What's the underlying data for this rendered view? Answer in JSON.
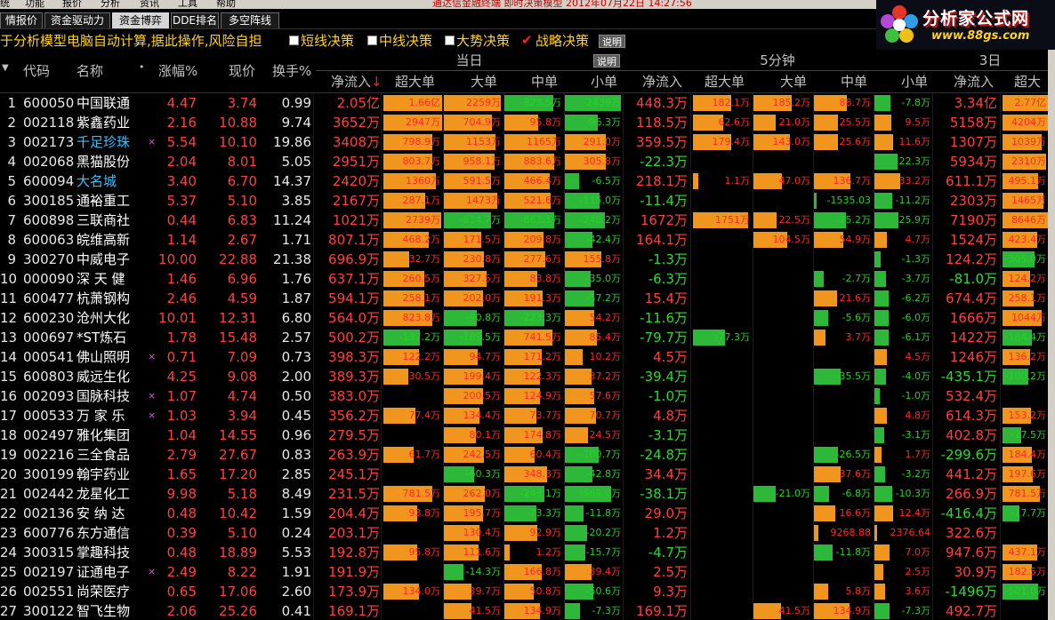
{
  "menubar": {
    "items": [
      "统",
      "功能",
      "报价",
      "分析",
      "资讯",
      "工具",
      "帮助"
    ],
    "title": "通达信金融终端  即时决策模型  2012年07月22日 14:27:56"
  },
  "tabs": [
    {
      "label": "情报价",
      "active": false
    },
    {
      "label": "资金驱动力",
      "active": false
    },
    {
      "label": "资金博弈",
      "active": true
    },
    {
      "label": "DDE排名",
      "active": false
    },
    {
      "label": "多空阵线",
      "active": false
    }
  ],
  "logo": {
    "title": "分析家公式网",
    "url": "www.88gs.com"
  },
  "decision_bar": {
    "text": "于分析模型电脑自动计算,据此操作,风险自担",
    "options": [
      {
        "label": "短线决策",
        "checked": false
      },
      {
        "label": "中线决策",
        "checked": false
      },
      {
        "label": "大势决策",
        "checked": false
      },
      {
        "label": "战略决策",
        "checked": true
      }
    ],
    "explain_label": "说明"
  },
  "header": {
    "columns": {
      "code": "代码",
      "name": "名称",
      "dot": "•",
      "change": "涨幅%",
      "price": "现价",
      "turnover": "换手%"
    },
    "sort_arrow": "↓",
    "groups": [
      {
        "label": "当日",
        "explain": "说明"
      },
      {
        "label": "5分钟",
        "explain": ""
      },
      {
        "label": "3日",
        "explain": ""
      }
    ],
    "sub": [
      "净流入",
      "超大单",
      "大单",
      "中单",
      "小单"
    ],
    "sub5": [
      "净流入",
      "超大单",
      "大单",
      "中单",
      "小单"
    ],
    "sub3": [
      "净流入",
      "超大"
    ]
  },
  "rows": [
    {
      "idx": "1",
      "code": "600050",
      "name": "中国联通",
      "mark": "",
      "hl": false,
      "chg": "4.47",
      "price": "3.74",
      "to": "0.99",
      "n1": "2.05亿",
      "b1": [
        "1.66亿",
        "2259万",
        "-823.5万",
        "-2439万"
      ],
      "n5": "448.3万",
      "b5": [
        "182.1万",
        "185.2万",
        "88.7万",
        "-7.8万"
      ],
      "n3": "3.34亿",
      "b3": "2.77亿"
    },
    {
      "idx": "2",
      "code": "002118",
      "name": "紫鑫药业",
      "mark": "",
      "hl": false,
      "chg": "2.16",
      "price": "10.88",
      "to": "9.74",
      "n1": "3652万",
      "b1": [
        "2947万",
        "704.9万",
        "95.8万",
        "-96.3万"
      ],
      "n5": "118.5万",
      "b5": [
        "62.6万",
        "21.0万",
        "25.5万",
        "9.5万"
      ],
      "n3": "5158万",
      "b3": "4204万"
    },
    {
      "idx": "3",
      "code": "002173",
      "name": "千足珍珠",
      "mark": "×",
      "hl": true,
      "chg": "5.54",
      "price": "10.10",
      "to": "19.86",
      "n1": "3408万",
      "b1": [
        "798.9万",
        "1153万",
        "1165万",
        "291.0万"
      ],
      "n5": "359.5万",
      "b5": [
        "179.4万",
        "143.0万",
        "25.6万",
        "11.6万"
      ],
      "n3": "1307万",
      "b3": "1039万"
    },
    {
      "idx": "4",
      "code": "002068",
      "name": "黑猫股份",
      "mark": "",
      "hl": false,
      "chg": "2.04",
      "price": "8.01",
      "to": "5.05",
      "n1": "2951万",
      "b1": [
        "803.7万",
        "958.1万",
        "883.6万",
        "305.8万"
      ],
      "n5": "-22.3万",
      "b5": [
        "",
        "",
        "",
        "-22.3万"
      ],
      "n3": "5934万",
      "b3": "2310万"
    },
    {
      "idx": "5",
      "code": "600094",
      "name": "大名城",
      "mark": "",
      "hl": true,
      "chg": "3.40",
      "price": "6.70",
      "to": "14.37",
      "n1": "2420万",
      "b1": [
        "1360万",
        "591.5万",
        "466.4万",
        "-6.5万"
      ],
      "n5": "218.1万",
      "b5": [
        "1.1万",
        "47.0万",
        "136.7万",
        "33.2万"
      ],
      "n3": "611.1万",
      "b3": "495.1万"
    },
    {
      "idx": "6",
      "code": "300185",
      "name": "通裕重工",
      "mark": "",
      "hl": false,
      "chg": "5.37",
      "price": "5.10",
      "to": "3.85",
      "n1": "2167万",
      "b1": [
        "287.1万",
        "1473万",
        "521.6万",
        "-115.0万"
      ],
      "n5": "-11.4万",
      "b5": [
        "",
        "",
        "-1535.03",
        "-11.2万"
      ],
      "n3": "2303万",
      "b3": "1465万"
    },
    {
      "idx": "7",
      "code": "600898",
      "name": "三联商社",
      "mark": "",
      "hl": false,
      "chg": "0.44",
      "price": "6.83",
      "to": "11.24",
      "n1": "1021万",
      "b1": [
        "2739万",
        "-614.7万",
        "-863.1万",
        "-240.2万"
      ],
      "n5": "1672万",
      "b5": [
        "1751万",
        "22.5万",
        "-75.2万",
        "-25.9万"
      ],
      "n3": "7190万",
      "b3": "8646万"
    },
    {
      "idx": "8",
      "code": "600063",
      "name": "皖维高新",
      "mark": "",
      "hl": false,
      "chg": "1.14",
      "price": "2.67",
      "to": "1.71",
      "n1": "807.1万",
      "b1": [
        "468.2万",
        "171.5万",
        "209.8万",
        "-42.4万"
      ],
      "n5": "164.1万",
      "b5": [
        "",
        "104.5万",
        "54.9万",
        "4.7万"
      ],
      "n3": "1524万",
      "b3": "423.4万"
    },
    {
      "idx": "9",
      "code": "300270",
      "name": "中威电子",
      "mark": "",
      "hl": false,
      "chg": "10.00",
      "price": "22.88",
      "to": "21.38",
      "n1": "696.9万",
      "b1": [
        "32.7万",
        "230.8万",
        "277.6万",
        "155.8万"
      ],
      "n5": "-1.3万",
      "b5": [
        "",
        "",
        "",
        "-1.3万"
      ],
      "n3": "124.2万",
      "b3": "-305.0万"
    },
    {
      "idx": "10",
      "code": "000090",
      "name": "深 天 健",
      "mark": "",
      "hl": false,
      "chg": "1.46",
      "price": "6.96",
      "to": "1.76",
      "n1": "637.1万",
      "b1": [
        "260.5万",
        "327.5万",
        "83.8万",
        "-35.0万"
      ],
      "n5": "-6.3万",
      "b5": [
        "",
        "",
        "-2.7万",
        "-3.7万"
      ],
      "n3": "-81.0万",
      "b3": "124.2万"
    },
    {
      "idx": "11",
      "code": "600477",
      "name": "杭萧钢构",
      "mark": "",
      "hl": false,
      "chg": "2.46",
      "price": "4.59",
      "to": "1.87",
      "n1": "594.1万",
      "b1": [
        "258.1万",
        "202.0万",
        "191.3万",
        "-57.2万"
      ],
      "n5": "15.4万",
      "b5": [
        "",
        "",
        "21.6万",
        "-6.2万"
      ],
      "n3": "674.4万",
      "b3": "258.1万"
    },
    {
      "idx": "12",
      "code": "600230",
      "name": "沧州大化",
      "mark": "",
      "hl": false,
      "chg": "10.01",
      "price": "12.31",
      "to": "6.80",
      "n1": "564.0万",
      "b1": [
        "823.8万",
        "-90.8万",
        "-223.3万",
        "54.2万"
      ],
      "n5": "-11.6万",
      "b5": [
        "",
        "",
        "-5.6万",
        "-6.0万"
      ],
      "n3": "1666万",
      "b3": "1044万"
    },
    {
      "idx": "13",
      "code": "000697",
      "name": "*ST炼石",
      "mark": "",
      "hl": false,
      "chg": "1.78",
      "price": "15.48",
      "to": "2.57",
      "n1": "500.2万",
      "b1": [
        "-137.2万",
        "-189.5万",
        "741.5万",
        "85.4万"
      ],
      "n5": "-79.7万",
      "b5": [
        "-77.3万",
        "",
        "3.7万",
        "-6.1万"
      ],
      "n3": "1422万",
      "b3": "-184.4万"
    },
    {
      "idx": "14",
      "code": "000541",
      "name": "佛山照明",
      "mark": "×",
      "hl": false,
      "chg": "0.71",
      "price": "7.09",
      "to": "0.73",
      "n1": "398.3万",
      "b1": [
        "122.2万",
        "94.7万",
        "171.2万",
        "10.2万"
      ],
      "n5": "4.5万",
      "b5": [
        "",
        "",
        "",
        "4.5万"
      ],
      "n3": "1246万",
      "b3": "136.2万"
    },
    {
      "idx": "15",
      "code": "600803",
      "name": "威远生化",
      "mark": "",
      "hl": false,
      "chg": "4.25",
      "price": "9.08",
      "to": "2.00",
      "n1": "389.3万",
      "b1": [
        "30.5万",
        "199.4万",
        "122.3万",
        "37.2万"
      ],
      "n5": "-39.4万",
      "b5": [
        "",
        "",
        "-35.5万",
        "-4.0万"
      ],
      "n3": "-435.1万",
      "b3": "-100.2万"
    },
    {
      "idx": "16",
      "code": "002093",
      "name": "国脉科技",
      "mark": "×",
      "hl": false,
      "chg": "1.07",
      "price": "4.74",
      "to": "0.50",
      "n1": "383.0万",
      "b1": [
        "",
        "200.5万",
        "124.9万",
        "57.6万"
      ],
      "n5": "-1.0万",
      "b5": [
        "",
        "",
        "",
        "-1.0万"
      ],
      "n3": "532.4万",
      "b3": ""
    },
    {
      "idx": "17",
      "code": "000533",
      "name": "万 家 乐",
      "mark": "×",
      "hl": false,
      "chg": "1.03",
      "price": "3.94",
      "to": "0.45",
      "n1": "356.2万",
      "b1": [
        "77.4万",
        "134.4万",
        "73.7万",
        "70.7万"
      ],
      "n5": "4.8万",
      "b5": [
        "",
        "",
        "",
        "4.8万"
      ],
      "n3": "614.3万",
      "b3": "153.2万"
    },
    {
      "idx": "18",
      "code": "002497",
      "name": "雅化集团",
      "mark": "",
      "hl": false,
      "chg": "1.04",
      "price": "14.55",
      "to": "0.96",
      "n1": "279.5万",
      "b1": [
        "",
        "80.1万",
        "174.8万",
        "24.5万"
      ],
      "n5": "-3.1万",
      "b5": [
        "",
        "",
        "",
        "-3.1万"
      ],
      "n3": "402.8万",
      "b3": "-27.5万"
    },
    {
      "idx": "19",
      "code": "002216",
      "name": "三全食品",
      "mark": "",
      "hl": false,
      "chg": "2.79",
      "price": "27.67",
      "to": "0.83",
      "n1": "263.9万",
      "b1": [
        "61.7万",
        "242.5万",
        "60.4万",
        "-100.7万"
      ],
      "n5": "-24.8万",
      "b5": [
        "",
        "",
        "-26.5万",
        "1.7万"
      ],
      "n3": "-299.6万",
      "b3": "184.4万"
    },
    {
      "idx": "20",
      "code": "300199",
      "name": "翰宇药业",
      "mark": "",
      "hl": false,
      "chg": "1.65",
      "price": "17.20",
      "to": "2.85",
      "n1": "245.1万",
      "b1": [
        "",
        "-60.3万",
        "348.3万",
        "-42.8万"
      ],
      "n5": "34.4万",
      "b5": [
        "",
        "",
        "37.6万",
        "-3.2万"
      ],
      "n3": "441.2万",
      "b3": "197.6万"
    },
    {
      "idx": "21",
      "code": "002442",
      "name": "龙星化工",
      "mark": "",
      "hl": false,
      "chg": "9.98",
      "price": "5.18",
      "to": "8.49",
      "n1": "231.5万",
      "b1": [
        "781.5万",
        "262.0万",
        "-243.1万",
        "-569.0万"
      ],
      "n5": "-38.1万",
      "b5": [
        "",
        "-21.0万",
        "-6.8万",
        "-10.3万"
      ],
      "n3": "266.9万",
      "b3": "781.5万"
    },
    {
      "idx": "22",
      "code": "002136",
      "name": "安 纳 达",
      "mark": "",
      "hl": false,
      "chg": "0.48",
      "price": "10.42",
      "to": "1.59",
      "n1": "204.4万",
      "b1": [
        "93.8万",
        "195.7万",
        "-73.3万",
        "-11.8万"
      ],
      "n5": "29.0万",
      "b5": [
        "",
        "",
        "16.6万",
        "12.4万"
      ],
      "n3": "-416.4万",
      "b3": "-17.7万"
    },
    {
      "idx": "23",
      "code": "600776",
      "name": "东方通信",
      "mark": "",
      "hl": false,
      "chg": "0.39",
      "price": "5.10",
      "to": "0.24",
      "n1": "203.1万",
      "b1": [
        "",
        "130.4万",
        "92.9万",
        "-20.2万"
      ],
      "n5": "1.2万",
      "b5": [
        "",
        "",
        "9268.88",
        "2376.64"
      ],
      "n3": "322.6万",
      "b3": ""
    },
    {
      "idx": "24",
      "code": "300315",
      "name": "掌趣科技",
      "mark": "",
      "hl": false,
      "chg": "0.48",
      "price": "18.89",
      "to": "5.53",
      "n1": "192.8万",
      "b1": [
        "95.8万",
        "111.6万",
        "1.2万",
        "-15.7万"
      ],
      "n5": "-4.7万",
      "b5": [
        "",
        "",
        "-11.8万",
        "7.0万"
      ],
      "n3": "947.6万",
      "b3": "437.1万"
    },
    {
      "idx": "25",
      "code": "002197",
      "name": "证通电子",
      "mark": "×",
      "hl": false,
      "chg": "2.49",
      "price": "8.22",
      "to": "1.91",
      "n1": "191.9万",
      "b1": [
        "",
        "-14.3万",
        "166.8万",
        "39.4万"
      ],
      "n5": "2.5万",
      "b5": [
        "",
        "",
        "",
        "2.5万"
      ],
      "n3": "30.9万",
      "b3": "182.5万"
    },
    {
      "idx": "26",
      "code": "002551",
      "name": "尚荣医疗",
      "mark": "",
      "hl": false,
      "chg": "0.65",
      "price": "17.06",
      "to": "2.60",
      "n1": "173.9万",
      "b1": [
        "134.0万",
        "39.7万",
        "50.8万",
        "-50.6万"
      ],
      "n5": "9.3万",
      "b5": [
        "",
        "",
        "5.8万",
        "3.6万"
      ],
      "n3": "-1496万",
      "b3": "-501.0万"
    },
    {
      "idx": "27",
      "code": "300122",
      "name": "智飞生物",
      "mark": "",
      "hl": false,
      "chg": "2.06",
      "price": "25.26",
      "to": "0.41",
      "n1": "169.1万",
      "b1": [
        "",
        "41.5万",
        "134.9万",
        "-7.3万"
      ],
      "n5": "169.1万",
      "b5": [
        "",
        "41.5万",
        "134.9万",
        "-7.3万"
      ],
      "n3": "492.7万",
      "b3": ""
    }
  ]
}
